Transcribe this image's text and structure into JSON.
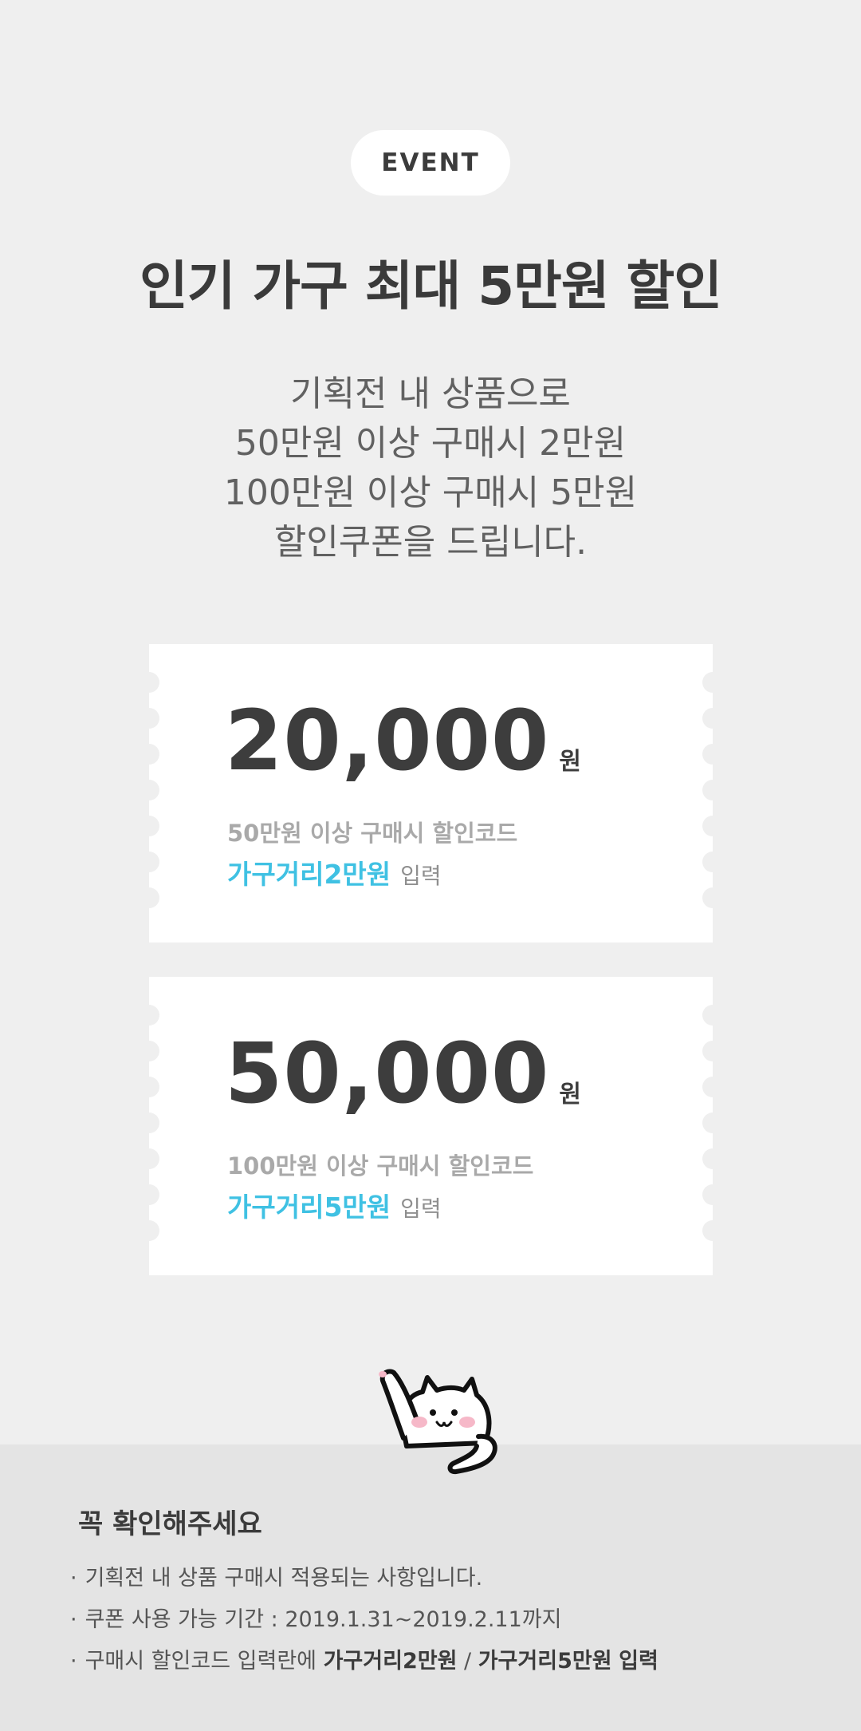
{
  "badge": "EVENT",
  "headline": "인기 가구 최대 5만원 할인",
  "description": [
    "기획전 내 상품으로",
    "50만원 이상 구매시 2만원",
    "100만원 이상 구매시 5만원",
    "할인쿠폰을 드립니다."
  ],
  "coupons": [
    {
      "amount": "20,000",
      "unit": "원",
      "condition": "50만원 이상 구매시 할인코드",
      "code": "가구거리2만원",
      "action": "입력"
    },
    {
      "amount": "50,000",
      "unit": "원",
      "condition": "100만원 이상 구매시 할인코드",
      "code": "가구거리5만원",
      "action": "입력"
    }
  ],
  "notice": {
    "title": "꼭 확인해주세요",
    "bullet": "·",
    "item1": "기획전 내 상품 구매시 적용되는 사항입니다.",
    "item2": "쿠폰 사용 가능 기간 : 2019.1.31~2019.2.11까지",
    "item3_prefix": "구매시 할인코드 입력란에",
    "item3_code1": "가구거리2만원",
    "item3_sep": "/",
    "item3_code2": "가구거리5만원",
    "item3_suffix": "입력"
  },
  "colors": {
    "background": "#efefef",
    "accent": "#3fc1e3",
    "notice_background": "#e4e4e4"
  },
  "icons": {
    "mascot": "waving-cat-mascot"
  }
}
